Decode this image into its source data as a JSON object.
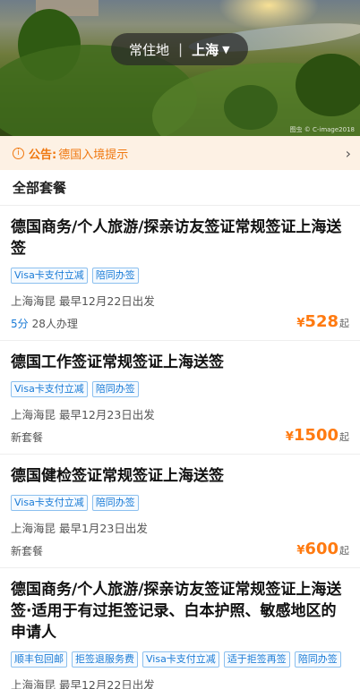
{
  "banner": {
    "city_label": "常住地",
    "separator": "|",
    "city": "上海",
    "watermark": "图虫 © C-image2018"
  },
  "notice": {
    "label": "公告:",
    "text": "德国入境提示"
  },
  "section_title": "全部套餐",
  "packages": [
    {
      "title": "德国商务/个人旅游/探亲访友签证常规签证上海送签",
      "tags": [
        "Visa卡支付立减",
        "陪同办签"
      ],
      "meta": "上海海昆  最早12月22日出发",
      "score": "5分",
      "extra": "28人办理",
      "price_symbol": "¥",
      "price": "528",
      "price_suffix": "起"
    },
    {
      "title": "德国工作签证常规签证上海送签",
      "tags": [
        "Visa卡支付立减",
        "陪同办签"
      ],
      "meta": "上海海昆  最早12月23日出发",
      "extra": "新套餐",
      "price_symbol": "¥",
      "price": "1500",
      "price_suffix": "起"
    },
    {
      "title": "德国健检签证常规签证上海送签",
      "tags": [
        "Visa卡支付立减",
        "陪同办签"
      ],
      "meta": "上海海昆  最早1月23日出发",
      "extra": "新套餐",
      "price_symbol": "¥",
      "price": "600",
      "price_suffix": "起"
    },
    {
      "title": "德国商务/个人旅游/探亲访友签证常规签证上海送签·适用于有过拒签记录、白本护照、敏感地区的申请人",
      "tags": [
        "顺丰包回邮",
        "拒签退服务费",
        "Visa卡支付立减",
        "适于拒签再签",
        "陪同办签"
      ],
      "meta": "上海海昆  最早12月22日出发"
    }
  ]
}
